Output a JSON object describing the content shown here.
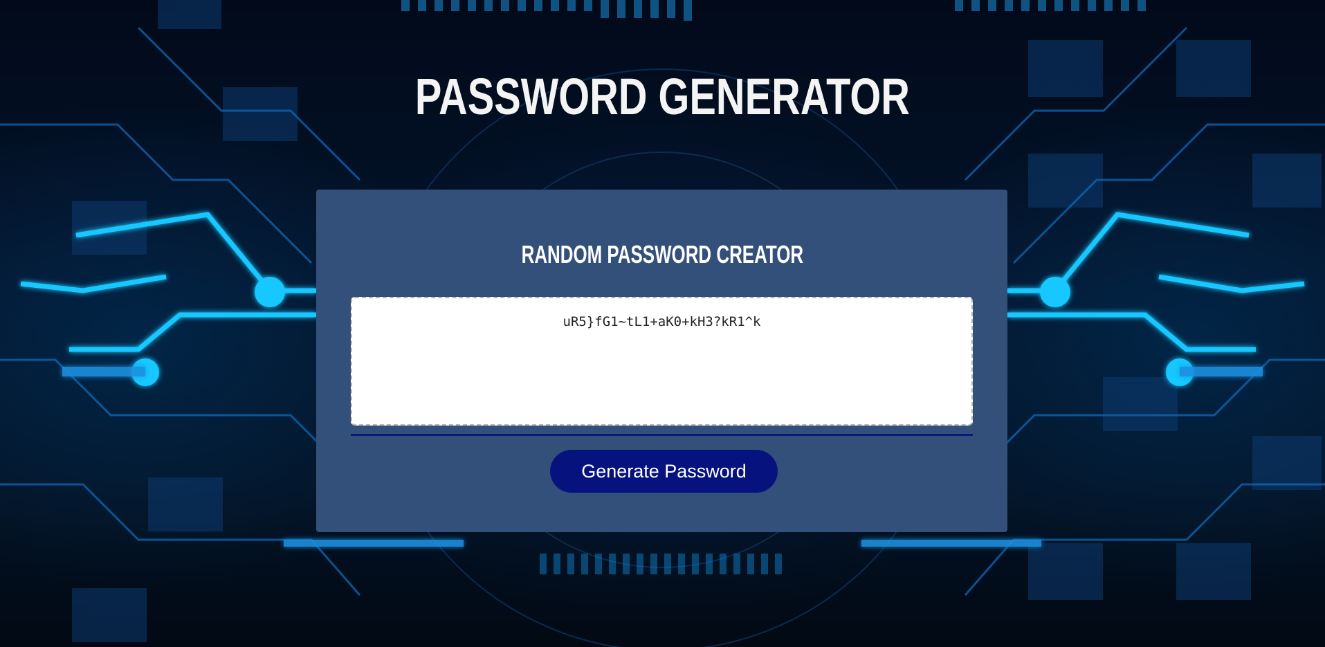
{
  "page": {
    "title": "PASSWORD GENERATOR"
  },
  "card": {
    "title": "RANDOM PASSWORD CREATOR",
    "password_value": "uR5}fG1~tL1+aK0+kH3?kR1^k",
    "generate_label": "Generate Password"
  },
  "colors": {
    "card_background": "#33507a",
    "button_background": "#06137f",
    "divider": "#0a1a7a",
    "glow": "#19c8ff"
  },
  "icons": {
    "background": "circuit-board-background"
  }
}
